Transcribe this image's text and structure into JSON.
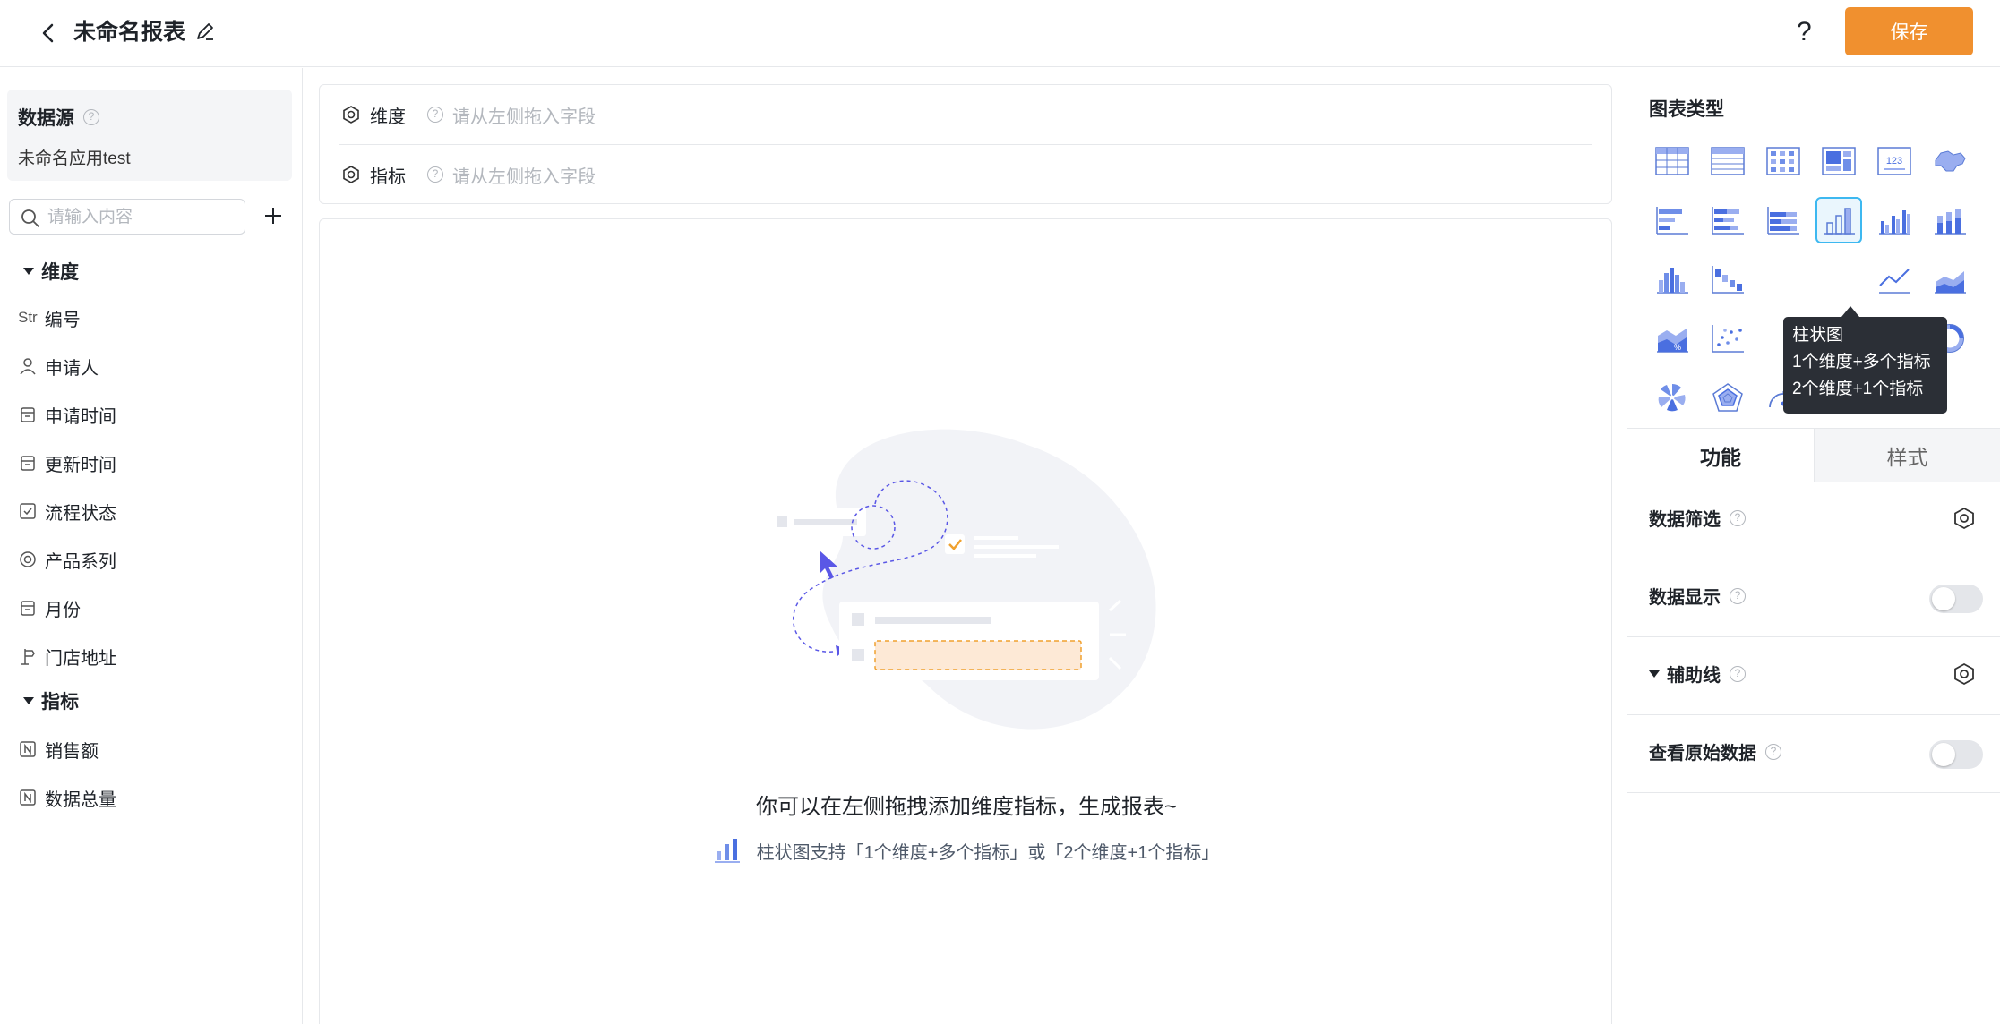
{
  "header": {
    "title": "未命名报表",
    "help": "?",
    "save_label": "保存"
  },
  "left": {
    "datasource_title": "数据源",
    "datasource_name": "未命名应用test",
    "search_placeholder": "请输入内容",
    "dimension_group": "维度",
    "dimensions": [
      {
        "icon": "Str",
        "label": "编号"
      },
      {
        "icon": "user-icon",
        "label": "申请人"
      },
      {
        "icon": "calendar-icon",
        "label": "申请时间"
      },
      {
        "icon": "calendar-icon",
        "label": "更新时间"
      },
      {
        "icon": "checkbox-icon",
        "label": "流程状态"
      },
      {
        "icon": "radio-icon",
        "label": "产品系列"
      },
      {
        "icon": "calendar-icon",
        "label": "月份"
      },
      {
        "icon": "location-icon",
        "label": "门店地址"
      }
    ],
    "measure_group": "指标",
    "measures": [
      {
        "icon": "number-icon",
        "label": "销售额"
      },
      {
        "icon": "number-icon",
        "label": "数据总量"
      }
    ]
  },
  "dropzone": {
    "dimension_label": "维度",
    "dimension_placeholder": "请从左侧拖入字段",
    "measure_label": "指标",
    "measure_placeholder": "请从左侧拖入字段"
  },
  "canvas": {
    "empty_message": "你可以在左侧拖拽添加维度指标，生成报表~",
    "hint": "柱状图支持「1个维度+多个指标」或「2个维度+1个指标」"
  },
  "right": {
    "chart_type_title": "图表类型",
    "tooltip": {
      "title": "柱状图",
      "line1": "1个维度+多个指标",
      "line2": "2个维度+1个指标"
    },
    "tabs": {
      "function": "功能",
      "style": "样式"
    },
    "options": {
      "data_filter": "数据筛选",
      "data_display": "数据显示",
      "aux_line": "辅助线",
      "raw_data": "查看原始数据"
    }
  },
  "colors": {
    "accent": "#f0902f",
    "chart_icon": "#5b7bd5",
    "selected_border": "#3db8f0"
  }
}
